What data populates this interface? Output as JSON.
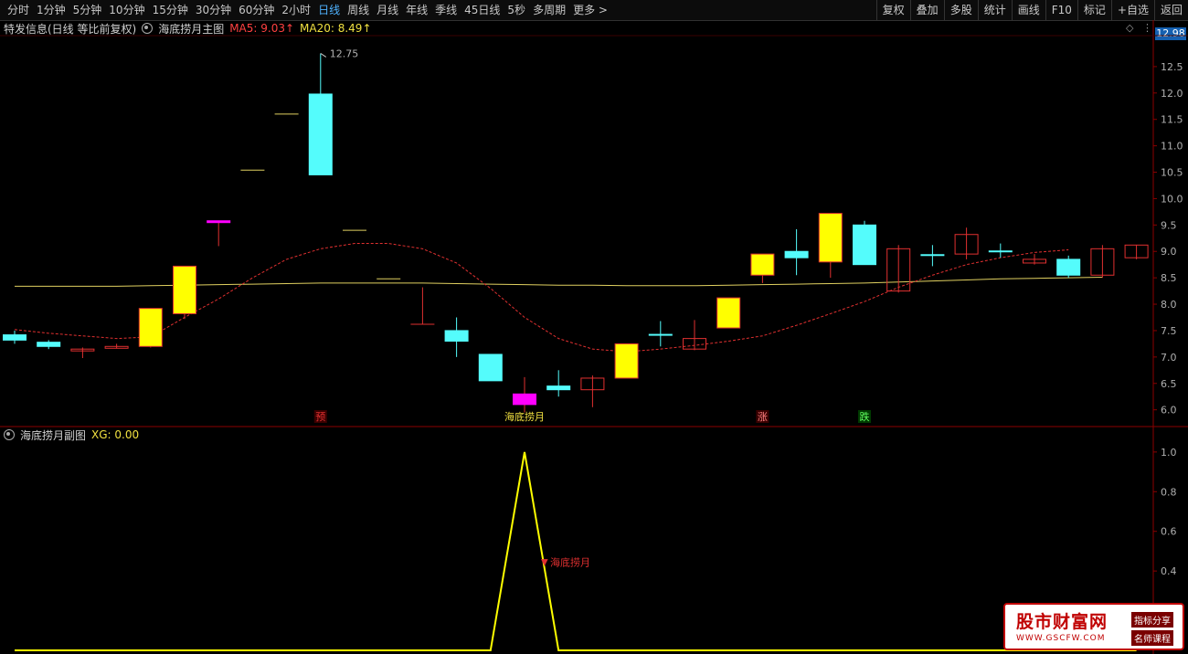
{
  "toolbar": {
    "periods": [
      "分时",
      "1分钟",
      "5分钟",
      "10分钟",
      "15分钟",
      "30分钟",
      "60分钟",
      "2小时",
      "日线",
      "周线",
      "月线",
      "年线",
      "季线",
      "45日线",
      "5秒",
      "多周期",
      "更多 >"
    ],
    "active": "日线",
    "right_items": [
      "复权",
      "叠加",
      "多股",
      "统计",
      "画线",
      "F10",
      "标记",
      "+自选",
      "返回"
    ]
  },
  "main_header": {
    "stock": "特发信息(日线 等比前复权)",
    "indicator": "海底捞月主图",
    "ma5": "MA5: 9.03↑",
    "ma20": "MA20: 8.49↑"
  },
  "sub_header": {
    "indicator": "海底捞月副图",
    "xg": "XG: 0.00"
  },
  "current_price": "12.98",
  "watermark": {
    "main": "股市财富网",
    "url": "WWW.GSCFW.COM",
    "tag1": "指标分享",
    "tag2": "名师课程"
  },
  "colors": {
    "up_yellow": "#ffff00",
    "down_cyan": "#54fcfc",
    "magenta": "#ff00ff",
    "red": "#e03030",
    "ma_line": "#e0d060",
    "sub_line": "#ffff00"
  },
  "chart_data": [
    {
      "type": "candlestick",
      "title": "海底捞月主图",
      "ylim": [
        5.7,
        13.0
      ],
      "y_ticks": [
        "12.5",
        "12.0",
        "11.5",
        "11.0",
        "10.5",
        "10.0",
        "9.5",
        "9.0",
        "8.5",
        "8.0",
        "7.5",
        "7.0",
        "6.5",
        "6.0"
      ],
      "candles": [
        {
          "o": 7.42,
          "c": 7.32,
          "h": 7.5,
          "l": 7.25,
          "k": "down"
        },
        {
          "o": 7.28,
          "c": 7.2,
          "h": 7.32,
          "l": 7.15,
          "k": "down"
        },
        {
          "o": 7.12,
          "c": 7.15,
          "h": 7.18,
          "l": 6.98,
          "k": "doji"
        },
        {
          "o": 7.18,
          "c": 7.2,
          "h": 7.25,
          "l": 7.16,
          "k": "doji"
        },
        {
          "o": 7.2,
          "c": 7.92,
          "h": 7.92,
          "l": 7.18,
          "k": "up"
        },
        {
          "o": 7.82,
          "c": 8.72,
          "h": 8.72,
          "l": 7.72,
          "k": "up"
        },
        {
          "o": 9.55,
          "c": 9.58,
          "h": 9.58,
          "l": 9.1,
          "k": "limit"
        },
        {
          "o": 10.54,
          "c": 10.54,
          "h": 10.54,
          "l": 10.54,
          "k": "flat"
        },
        {
          "o": 11.6,
          "c": 11.6,
          "h": 11.6,
          "l": 11.6,
          "k": "flat"
        },
        {
          "o": 11.98,
          "c": 10.45,
          "h": 12.75,
          "l": 10.45,
          "k": "down"
        },
        {
          "o": 9.4,
          "c": 9.4,
          "h": 9.4,
          "l": 9.4,
          "k": "flat"
        },
        {
          "o": 8.48,
          "c": 8.48,
          "h": 8.48,
          "l": 8.48,
          "k": "flat"
        },
        {
          "o": 7.62,
          "c": 7.62,
          "h": 8.32,
          "l": 7.62,
          "k": "flat_red"
        },
        {
          "o": 7.5,
          "c": 7.3,
          "h": 7.75,
          "l": 7.0,
          "k": "down"
        },
        {
          "o": 7.05,
          "c": 6.55,
          "h": 7.05,
          "l": 6.55,
          "k": "down"
        },
        {
          "o": 6.3,
          "c": 6.1,
          "h": 6.62,
          "l": 5.95,
          "k": "limit"
        },
        {
          "o": 6.45,
          "c": 6.38,
          "h": 6.75,
          "l": 6.25,
          "k": "down"
        },
        {
          "o": 6.38,
          "c": 6.6,
          "h": 6.65,
          "l": 6.05,
          "k": "up_red"
        },
        {
          "o": 6.6,
          "c": 7.25,
          "h": 7.25,
          "l": 6.6,
          "k": "up"
        },
        {
          "o": 7.42,
          "c": 7.42,
          "h": 7.68,
          "l": 7.2,
          "k": "doji_c"
        },
        {
          "o": 7.15,
          "c": 7.35,
          "h": 7.7,
          "l": 7.13,
          "k": "up_red"
        },
        {
          "o": 7.55,
          "c": 8.12,
          "h": 8.12,
          "l": 7.55,
          "k": "up"
        },
        {
          "o": 8.55,
          "c": 8.95,
          "h": 8.95,
          "l": 8.4,
          "k": "up"
        },
        {
          "o": 9.0,
          "c": 8.88,
          "h": 9.42,
          "l": 8.55,
          "k": "down"
        },
        {
          "o": 8.8,
          "c": 9.72,
          "h": 9.72,
          "l": 8.5,
          "k": "up"
        },
        {
          "o": 9.5,
          "c": 8.75,
          "h": 9.58,
          "l": 8.75,
          "k": "down"
        },
        {
          "o": 8.25,
          "c": 9.05,
          "h": 9.12,
          "l": 8.22,
          "k": "up_red"
        },
        {
          "o": 8.93,
          "c": 8.93,
          "h": 9.12,
          "l": 8.72,
          "k": "doji_c"
        },
        {
          "o": 8.95,
          "c": 9.32,
          "h": 9.45,
          "l": 8.85,
          "k": "up_red"
        },
        {
          "o": 9.0,
          "c": 9.0,
          "h": 9.15,
          "l": 8.88,
          "k": "doji_c"
        },
        {
          "o": 8.78,
          "c": 8.85,
          "h": 8.95,
          "l": 8.75,
          "k": "up_red"
        },
        {
          "o": 8.85,
          "c": 8.55,
          "h": 8.92,
          "l": 8.5,
          "k": "down"
        },
        {
          "o": 8.55,
          "c": 9.05,
          "h": 9.12,
          "l": 8.5,
          "k": "up_red"
        },
        {
          "o": 8.88,
          "c": 9.12,
          "h": 9.12,
          "l": 8.85,
          "k": "up_red"
        }
      ],
      "ma20": [
        8.34,
        8.34,
        8.34,
        8.34,
        8.35,
        8.36,
        8.37,
        8.38,
        8.39,
        8.4,
        8.4,
        8.4,
        8.4,
        8.39,
        8.38,
        8.37,
        8.36,
        8.36,
        8.35,
        8.35,
        8.35,
        8.36,
        8.37,
        8.38,
        8.39,
        8.4,
        8.42,
        8.44,
        8.46,
        8.48,
        8.49,
        8.5,
        8.51
      ],
      "ma_dashed": [
        7.52,
        7.45,
        7.4,
        7.35,
        7.38,
        7.75,
        8.1,
        8.5,
        8.85,
        9.05,
        9.15,
        9.15,
        9.05,
        8.78,
        8.3,
        7.75,
        7.35,
        7.15,
        7.1,
        7.15,
        7.22,
        7.3,
        7.4,
        7.6,
        7.82,
        8.05,
        8.32,
        8.55,
        8.75,
        8.88,
        8.98,
        9.03
      ],
      "max_label": "12.75",
      "annotations": [
        {
          "i": 9,
          "text": "预",
          "color": "#e03030",
          "bg": "#3a0000"
        },
        {
          "i": 15,
          "text": "海底捞月",
          "color": "#f0e040",
          "bg": ""
        },
        {
          "i": 22,
          "text": "涨",
          "color": "#ff8080",
          "bg": "#3a0000"
        },
        {
          "i": 25,
          "text": "跌",
          "color": "#60ff60",
          "bg": "#003a00"
        }
      ]
    },
    {
      "type": "line",
      "title": "海底捞月副图",
      "ylim": [
        0,
        1.05
      ],
      "y_ticks": [
        "1.0",
        "0.8",
        "0.6",
        "0.4"
      ],
      "y_tick_values": [
        1.0,
        0.8,
        0.6,
        0.4
      ],
      "values": [
        0,
        0,
        0,
        0,
        0,
        0,
        0,
        0,
        0,
        0,
        0,
        0,
        0,
        0,
        0,
        1,
        0,
        0,
        0,
        0,
        0,
        0,
        0,
        0,
        0,
        0,
        0,
        0,
        0,
        0,
        0,
        0,
        0,
        0
      ],
      "signal_label": "海底捞月"
    }
  ]
}
